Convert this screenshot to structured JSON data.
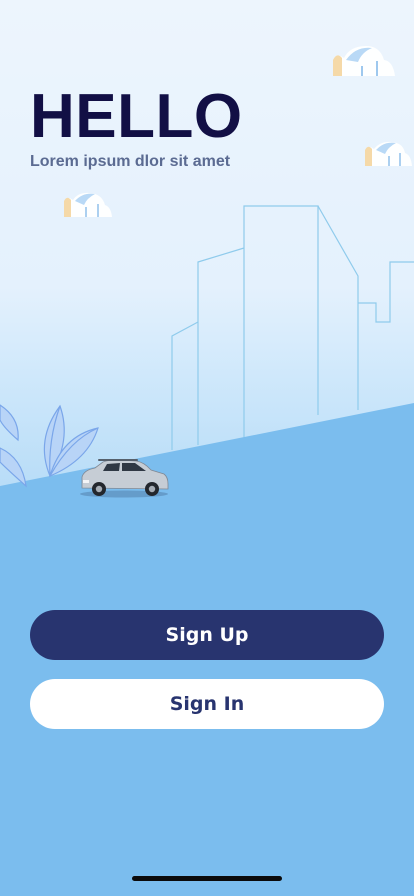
{
  "header": {
    "title": "HELLO",
    "subtitle": "Lorem ipsum dlor sit amet"
  },
  "actions": {
    "signup_label": "Sign Up",
    "signin_label": "Sign In"
  },
  "colors": {
    "title": "#120f45",
    "subtitle": "#5b6b92",
    "primary_button": "#28346f",
    "secondary_button": "#ffffff",
    "ground": "#7bbdee",
    "sky": "#e4f1fd"
  },
  "illustration": {
    "icons": [
      "cloud-icon",
      "city-skyline",
      "leaf-plant-icon",
      "car-icon"
    ]
  }
}
